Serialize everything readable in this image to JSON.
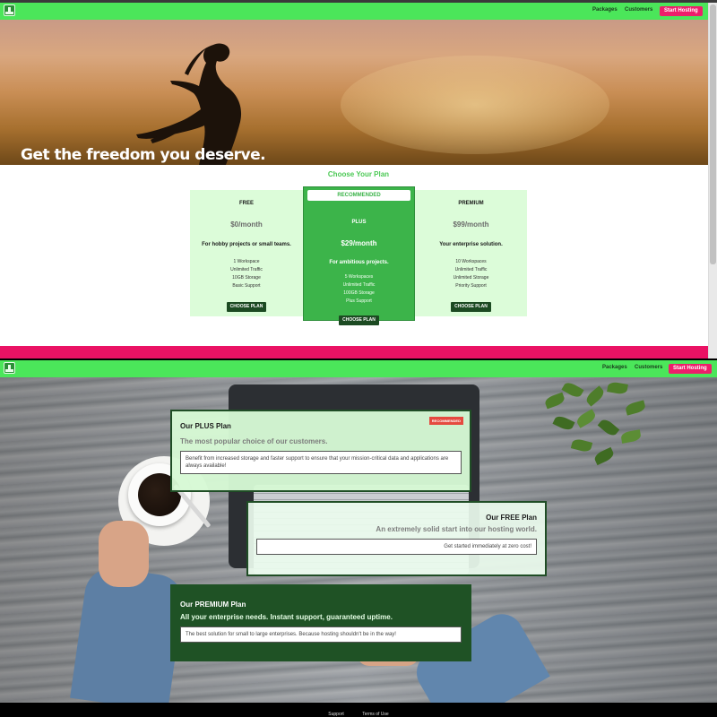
{
  "nav": {
    "links": [
      "Packages",
      "Customers"
    ],
    "cta": "Start Hosting"
  },
  "hero": {
    "title": "Get the freedom you deserve."
  },
  "plans": {
    "heading": "Choose Your Plan",
    "recommended_label": "RECOMMENDED",
    "items": [
      {
        "name": "FREE",
        "price": "$0/month",
        "tagline": "For hobby projects or small teams.",
        "features": [
          "1 Workspace",
          "Unlimited Traffic",
          "10GB Storage",
          "Basic Support"
        ],
        "button": "CHOOSE PLAN"
      },
      {
        "name": "PLUS",
        "price": "$29/month",
        "tagline": "For ambitious projects.",
        "features": [
          "5 Workspaces",
          "Unlimited Traffic",
          "100GB Storage",
          "Plus Support"
        ],
        "button": "CHOOSE PLAN"
      },
      {
        "name": "PREMIUM",
        "price": "$99/month",
        "tagline": "Your enterprise solution.",
        "features": [
          "10 Workspaces",
          "Unlimited Traffic",
          "Unlimited Storage",
          "Priority Support"
        ],
        "button": "CHOOSE PLAN"
      }
    ]
  },
  "packages": {
    "plus": {
      "title": "Our PLUS Plan",
      "badge": "RECOMMENDED",
      "subtitle": "The most popular choice of our customers.",
      "text": "Benefit from increased storage and faster support to ensure that your mission-critical data and applications are always available!"
    },
    "free": {
      "title": "Our FREE Plan",
      "subtitle": "An extremely solid start into our hosting world.",
      "text": "Get started immediately at zero cost!"
    },
    "premium": {
      "title": "Our PREMIUM Plan",
      "subtitle": "All your enterprise needs. Instant support, guaranteed uptime.",
      "text": "The best solution for small to large enterprises. Because hosting shouldn't be in the way!"
    }
  },
  "footer": {
    "links": [
      "Support",
      "Terms of Use"
    ]
  },
  "colors": {
    "nav_green": "#4be65a",
    "accent_pink": "#ee1d6b",
    "plan_green": "#3cb44a",
    "dark_green": "#1f5225"
  }
}
